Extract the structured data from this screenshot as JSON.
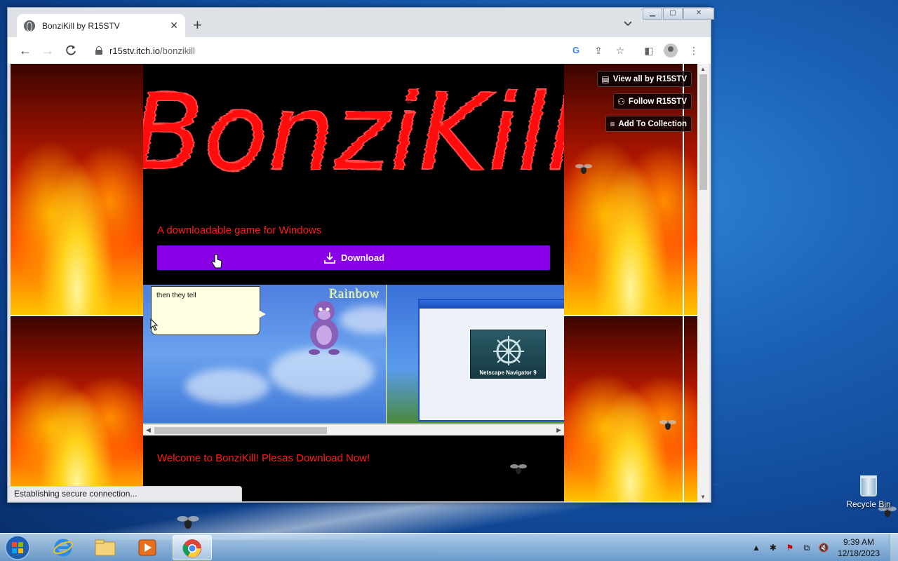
{
  "browser": {
    "tab_title": "BonziKill by R15STV",
    "tab_close": "✕",
    "new_tab": "+",
    "url_host": "r15stv.itch.io",
    "url_path": "/bonzikill",
    "status_text": "Establishing secure connection..."
  },
  "page": {
    "logo_text": "BonziKill",
    "tagline": "A downloadable game for Windows",
    "download_label": "Download",
    "screenshot1_bubble": "then they tell",
    "screenshot1_overlay": "Rainbow",
    "screenshot2_label": "Netscape Navigator 9",
    "welcome": "Welcome to BonziKill! Plesas Download Now!",
    "user_tools": {
      "view_all": "View all by R15STV",
      "follow": "Follow R15STV",
      "add_collection": "Add To Collection"
    }
  },
  "desktop": {
    "recycle_bin_label": "Recycle Bin"
  },
  "taskbar": {
    "time": "9:39 AM",
    "date": "12/18/2023"
  },
  "colors": {
    "download_button": "#8a00e6",
    "page_text_red": "#ff1c1c",
    "page_background": "#000000"
  }
}
